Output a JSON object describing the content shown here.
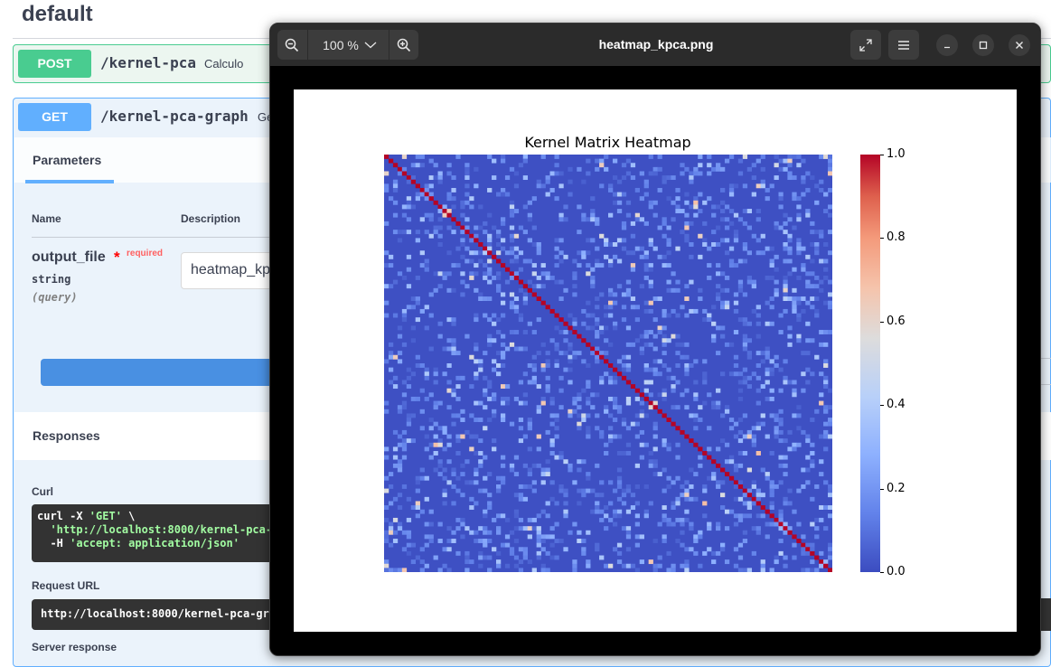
{
  "swagger": {
    "section_title": "default",
    "post_op": {
      "method": "POST",
      "path": "/kernel-pca",
      "summary": "Calculo"
    },
    "get_op": {
      "method": "GET",
      "path": "/kernel-pca-graph",
      "summary": "Ge",
      "tab_parameters": "Parameters",
      "col_name": "Name",
      "col_description": "Description",
      "param": {
        "name": "output_file",
        "required_star": "*",
        "required_label": "required",
        "type": "string",
        "location": "(query)",
        "value": "heatmap_kp"
      },
      "responses_label": "Responses",
      "curl_label": "Curl",
      "curl_lines": {
        "l1a": "curl -X ",
        "l1b": "'GET'",
        "l1c": " \\",
        "l2": "  'http://localhost:8000/kernel-pca-",
        "l3a": "  -H ",
        "l3b": "'accept: application/json'"
      },
      "request_url_label": "Request URL",
      "request_url": "http://localhost:8000/kernel-pca-gr",
      "server_response_label": "Server response"
    }
  },
  "viewer": {
    "title": "heatmap_kpca.png",
    "zoom": "100 %",
    "icons": {
      "zoom_out": "zoom-out-icon",
      "zoom_in": "zoom-in-icon",
      "dropdown": "chevron-down-icon",
      "fullscreen": "fullscreen-icon",
      "menu": "hamburger-menu-icon",
      "minimize": "minimize-icon",
      "maximize": "maximize-icon",
      "close": "close-icon"
    }
  },
  "chart_data": {
    "type": "heatmap",
    "title": "Kernel Matrix Heatmap",
    "n": 100,
    "diagonal_value": 1.0,
    "off_diagonal_typical": [
      0.0,
      0.3
    ],
    "off_diagonal_max": 0.7,
    "colormap": "coolwarm",
    "colorbar": {
      "ticks": [
        "0.0",
        "0.2",
        "0.4",
        "0.6",
        "0.8",
        "1.0"
      ],
      "range": [
        0.0,
        1.0
      ]
    },
    "xlabel": "",
    "ylabel": ""
  }
}
